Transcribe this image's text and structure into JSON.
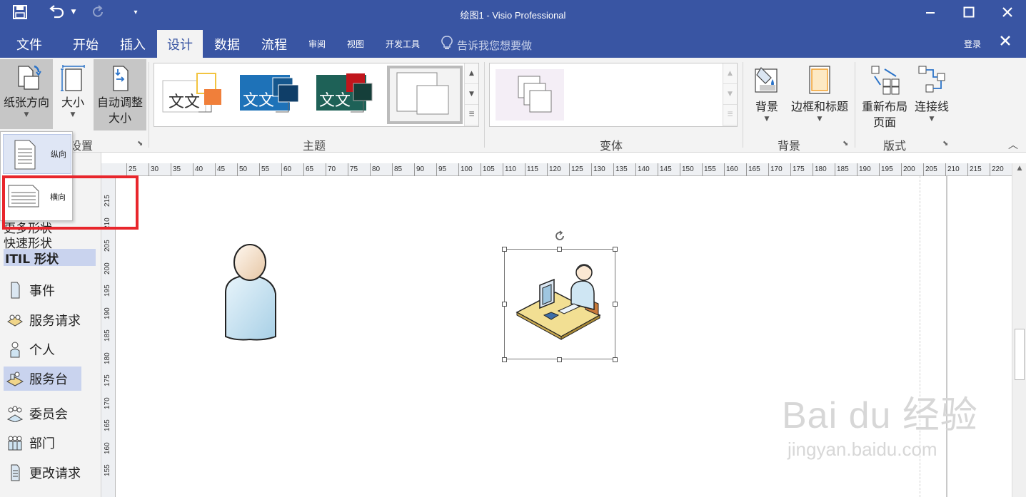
{
  "window": {
    "title": "绘图1 - Visio Professional",
    "minimize_icon": "minimize-icon",
    "maximize_icon": "maximize-icon",
    "close_icon": "close-icon"
  },
  "quick_access": {
    "save_icon": "save-icon",
    "undo_icon": "undo-icon",
    "redo_icon": "redo-icon",
    "customize_icon": "customize-icon"
  },
  "tabs": [
    {
      "label": "文件"
    },
    {
      "label": "开始"
    },
    {
      "label": "插入"
    },
    {
      "label": "设计"
    },
    {
      "label": "数据"
    },
    {
      "label": "流程"
    },
    {
      "label": "审阅"
    },
    {
      "label": "视图"
    },
    {
      "label": "开发工具"
    }
  ],
  "active_tab": "设计",
  "tell_me": "告诉我您想要做",
  "signin": "登录",
  "ribbon": {
    "page_setup": {
      "orientation": "纸张方向",
      "size": "大小",
      "auto_size_line1": "自动调整",
      "auto_size_line2": "大小",
      "group_label": "设置"
    },
    "themes": {
      "group_label": "主题",
      "theme_text": "文文"
    },
    "variants": {
      "group_label": "变体"
    },
    "backgrounds": {
      "background": "背景",
      "borders_titles": "边框和标题",
      "group_label": "背景"
    },
    "layout": {
      "relayout_line1": "重新布局",
      "relayout_line2": "页面",
      "connectors": "连接线",
      "group_label": "版式"
    }
  },
  "orientation_menu": {
    "portrait": "纵向",
    "landscape": "横向"
  },
  "shapes_panel": {
    "more_shapes": "更多形状",
    "quick_shapes": "快速形状",
    "stencil": "ITIL 形状",
    "items": [
      {
        "label": "事件"
      },
      {
        "label": "服务请求"
      },
      {
        "label": "个人"
      },
      {
        "label": "服务台"
      },
      {
        "label": "委员会"
      },
      {
        "label": "部门"
      },
      {
        "label": "更改请求"
      }
    ],
    "selected_item": "服务台"
  },
  "ruler": {
    "x_ticks": [
      "25",
      "30",
      "35",
      "40",
      "45",
      "50",
      "55",
      "60",
      "65",
      "70",
      "75",
      "80",
      "85",
      "90",
      "95",
      "100",
      "105",
      "110",
      "115",
      "120",
      "125",
      "130",
      "135",
      "140",
      "145",
      "150",
      "155",
      "160",
      "165",
      "170",
      "175",
      "180",
      "185",
      "190",
      "195",
      "200",
      "205",
      "210",
      "215",
      "220"
    ],
    "y_ticks": [
      "215",
      "210",
      "205",
      "200",
      "195",
      "190",
      "185",
      "180",
      "175",
      "170",
      "165",
      "160",
      "155"
    ]
  },
  "watermark": {
    "main": "Bai du 经验",
    "sub": "jingyan.baidu.com"
  },
  "colors": {
    "title_bar": "#3955a3",
    "ribbon": "#f3f3f3",
    "highlight_red": "#e8262c",
    "selected": "#c9d3ee"
  }
}
